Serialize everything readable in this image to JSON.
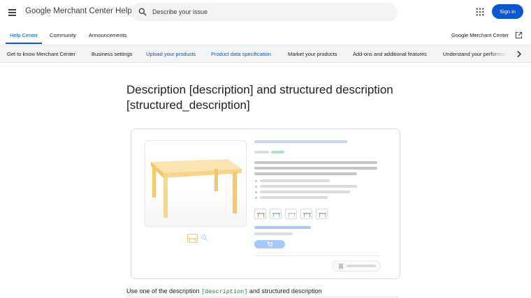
{
  "header": {
    "app_title": "Google Merchant Center Help",
    "search_placeholder": "Describe your issue",
    "sign_in_label": "Sign in"
  },
  "nav": {
    "items": [
      {
        "label": "Help Center",
        "active": true
      },
      {
        "label": "Community",
        "active": false
      },
      {
        "label": "Announcements",
        "active": false
      }
    ],
    "external_link_label": "Google Merchant Center"
  },
  "categories": [
    {
      "label": "Get to know Merchant Center",
      "active": false
    },
    {
      "label": "Business settings",
      "active": false
    },
    {
      "label": "Upload your products",
      "active": true
    },
    {
      "label": "Product data specification",
      "active": true
    },
    {
      "label": "Market your products",
      "active": false
    },
    {
      "label": "Add-ons and additional features",
      "active": false
    },
    {
      "label": "Understand your performance",
      "active": false
    }
  ],
  "article": {
    "title": "Description [description] and structured description [structured_description]",
    "intro_prefix": "Use one of the description ",
    "intro_code": "[description]",
    "intro_suffix": " and structured description"
  },
  "colors": {
    "accent": "#0b57d0",
    "code_green": "#188038",
    "table_wood": "#f8d58a"
  },
  "icons": [
    "menu-icon",
    "search-icon",
    "apps-grid-icon",
    "external-link-icon",
    "chevron-right-icon",
    "zoom-icon",
    "cart-icon",
    "bookmark-icon"
  ]
}
